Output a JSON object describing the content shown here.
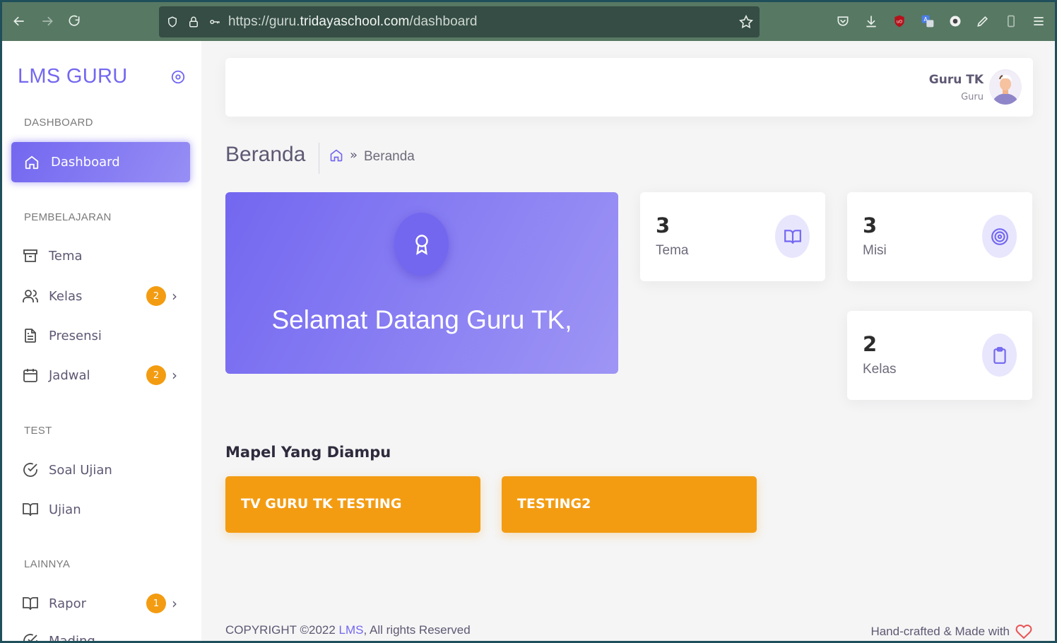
{
  "browser": {
    "url_prefix": "https://guru.",
    "url_domain": "tridayaschool.com",
    "url_path": "/dashboard"
  },
  "sidebar": {
    "brand": "LMS GURU",
    "sections": {
      "dashboard": "DASHBOARD",
      "pembelajaran": "PEMBELAJARAN",
      "test": "TEST",
      "lainnya": "LAINNYA"
    },
    "active_item": {
      "label": "Dashboard",
      "icon": "home-icon"
    },
    "items": [
      {
        "label": "Tema",
        "icon": "archive-icon"
      },
      {
        "label": "Kelas",
        "icon": "users-icon",
        "badge": "2"
      },
      {
        "label": "Presensi",
        "icon": "file-text-icon"
      },
      {
        "label": "Jadwal",
        "icon": "calendar-icon",
        "badge": "2"
      },
      {
        "label": "Soal Ujian",
        "icon": "check-circle-icon"
      },
      {
        "label": "Ujian",
        "icon": "book-open-icon"
      },
      {
        "label": "Rapor",
        "icon": "book-open-icon",
        "badge": "1"
      },
      {
        "label": "Mading",
        "icon": "check-icon"
      }
    ]
  },
  "header": {
    "user_name": "Guru TK",
    "user_role": "Guru"
  },
  "breadcrumb": {
    "title": "Beranda",
    "separator": "»",
    "current": "Beranda"
  },
  "welcome": {
    "text": "Selamat Datang Guru TK,"
  },
  "stats": [
    {
      "value": "3",
      "label": "Tema",
      "icon": "book-open-icon"
    },
    {
      "value": "3",
      "label": "Misi",
      "icon": "target-icon"
    },
    {
      "value": "2",
      "label": "Kelas",
      "icon": "clipboard-icon"
    }
  ],
  "mapel": {
    "title": "Mapel Yang Diampu",
    "items": [
      "TV GURU TK TESTING",
      "TESTING2"
    ]
  },
  "footer": {
    "copyright_prefix": "COPYRIGHT ©2022 ",
    "copyright_link": "LMS",
    "copyright_suffix": ", All rights Reserved",
    "made_with": "Hand-crafted & Made with"
  },
  "colors": {
    "primary": "#7367f0",
    "warning": "#f39c12",
    "toolbar": "#577863",
    "danger": "#ea5455"
  }
}
